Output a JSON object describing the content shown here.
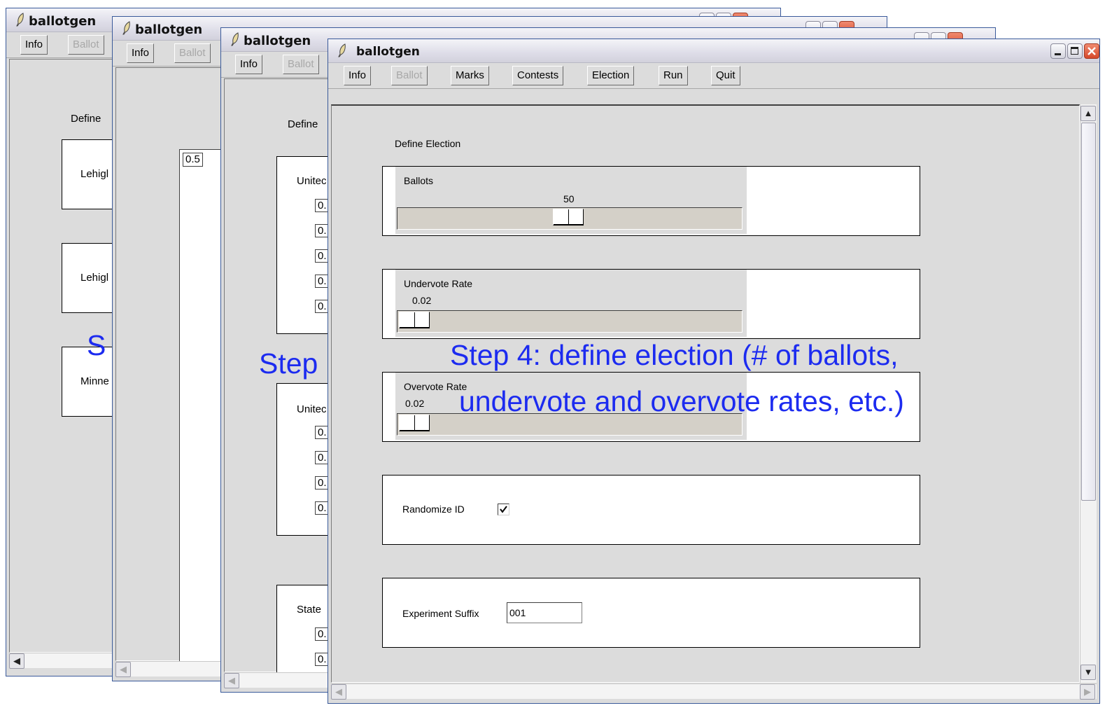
{
  "app_title": "ballotgen",
  "menu": {
    "info": "Info",
    "ballot": "Ballot",
    "marks": "Marks",
    "contests": "Contests",
    "election": "Election",
    "run": "Run",
    "quit": "Quit"
  },
  "window1": {
    "section_title": "Define",
    "frames": [
      "Lehigl",
      "Lehigl",
      "Minne"
    ],
    "overlay": "S"
  },
  "window2": {
    "entry_value": "0.5"
  },
  "window3": {
    "section_title": "Define",
    "overlay": "Step",
    "frames": [
      {
        "label": "Unitec",
        "values": [
          "0.",
          "0.",
          "0.",
          "0.",
          "0."
        ]
      },
      {
        "label": "Unitec",
        "values": [
          "0.",
          "0.",
          "0.",
          "0."
        ]
      },
      {
        "label": "State",
        "values": [
          "0.",
          "0."
        ]
      }
    ]
  },
  "main": {
    "section_title": "Define Election",
    "ballots": {
      "label": "Ballots",
      "value": "50",
      "level": 0.5
    },
    "undervote": {
      "label": "Undervote Rate",
      "value": "0.02",
      "level": 0.02
    },
    "overvote": {
      "label": "Overvote Rate",
      "value": "0.02",
      "level": 0.02
    },
    "randomize": {
      "label": "Randomize ID",
      "checked": true
    },
    "suffix": {
      "label": "Experiment Suffix",
      "value": "001"
    }
  },
  "overlay_text": {
    "line1": "Step 4:  define election (# of ballots,",
    "line2": "undervote and overvote rates, etc.)"
  },
  "colors": {
    "overlay": "#1c2bf0",
    "close_button": "#d6482a"
  }
}
